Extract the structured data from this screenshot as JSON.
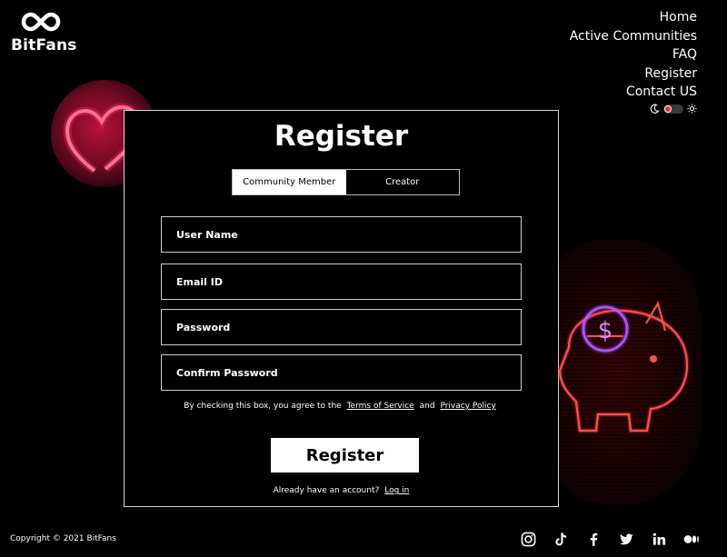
{
  "brand": {
    "name": "BitFans",
    "logo_icon": "infinity-logo-icon"
  },
  "nav": {
    "items": [
      {
        "label": "Home"
      },
      {
        "label": "Active Communities"
      },
      {
        "label": "FAQ"
      },
      {
        "label": "Register"
      },
      {
        "label": "Contact US"
      }
    ],
    "theme_toggle": {
      "left_icon": "moon-icon",
      "right_icon": "sun-icon",
      "state": "dark"
    }
  },
  "form": {
    "title": "Register",
    "tabs": [
      {
        "label": "Community Member",
        "active": true
      },
      {
        "label": "Creator",
        "active": false
      }
    ],
    "fields": {
      "username_placeholder": "User Name",
      "email_placeholder": "Email ID",
      "password_placeholder": "Password",
      "confirm_placeholder": "Confirm Password"
    },
    "terms": {
      "prefix": "By checking this box, you agree to the",
      "tos_link": "Terms of Service",
      "and": "and",
      "privacy_link": "Privacy Policy"
    },
    "submit_label": "Register",
    "login_prompt": "Already have an account?",
    "login_link": "Log in"
  },
  "footer": {
    "copyright": "Copyright © 2021 BitFans",
    "socials": [
      "instagram-icon",
      "tiktok-icon",
      "facebook-icon",
      "twitter-icon",
      "linkedin-icon",
      "medium-icon"
    ]
  },
  "colors": {
    "accent": "#ff2a2a",
    "background": "#000000",
    "text": "#ffffff"
  }
}
